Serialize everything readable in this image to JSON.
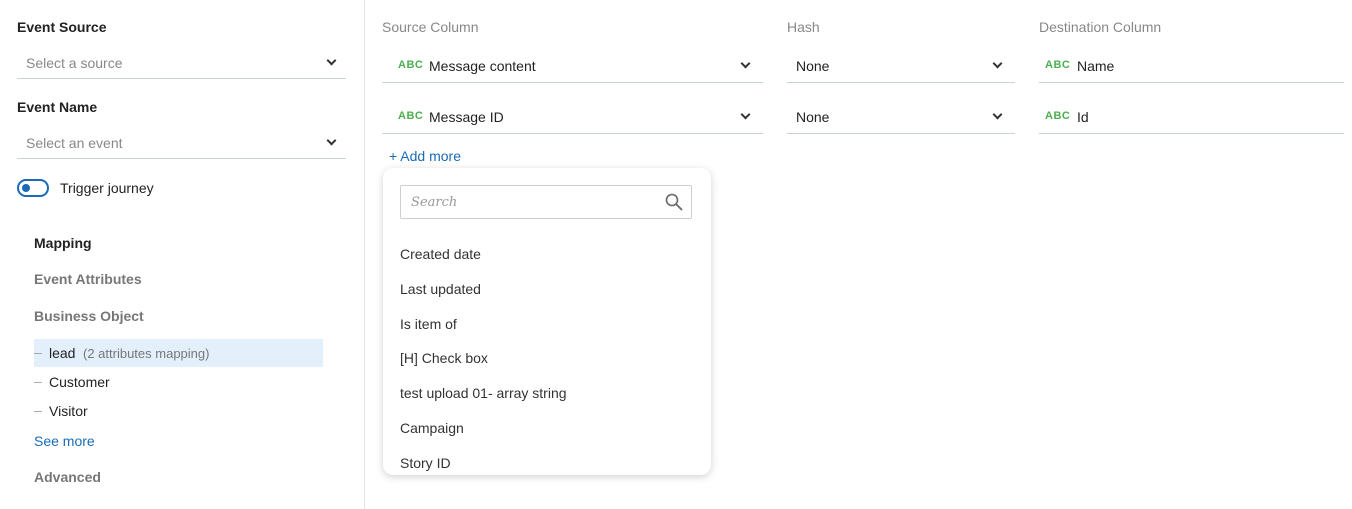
{
  "left_panel": {
    "event_source": {
      "label": "Event Source",
      "placeholder": "Select a source"
    },
    "event_name": {
      "label": "Event Name",
      "placeholder": "Select an event"
    },
    "trigger": {
      "label": "Trigger journey",
      "on": true
    },
    "nav": {
      "mapping": "Mapping",
      "event_attributes": "Event Attributes",
      "business_object": "Business Object",
      "tree": [
        {
          "label": "lead",
          "sub": "(2 attributes mapping)",
          "selected": true
        },
        {
          "label": "Customer",
          "sub": ""
        },
        {
          "label": "Visitor",
          "sub": ""
        }
      ],
      "see_more": "See more",
      "advanced": "Advanced"
    }
  },
  "mapping_table": {
    "headers": {
      "source": "Source Column",
      "hash": "Hash",
      "destination": "Destination Column"
    },
    "type_badge": "ABC",
    "rows": [
      {
        "source": "Message content",
        "hash": "None",
        "destination": "Name"
      },
      {
        "source": "Message ID",
        "hash": "None",
        "destination": "Id"
      }
    ],
    "add_more": "+ Add more"
  },
  "dropdown": {
    "search_placeholder": "Search",
    "options": [
      "Created date",
      "Last updated",
      "Is item of",
      "[H] Check box",
      "test upload 01- array string",
      "Campaign",
      "Story ID"
    ]
  },
  "colors": {
    "accent": "#1a6bb5",
    "badge": "#4caf50",
    "selected_bg": "#e3f0fc"
  },
  "icons": {
    "search": "search-icon",
    "chevron": "chevron-down-icon"
  }
}
